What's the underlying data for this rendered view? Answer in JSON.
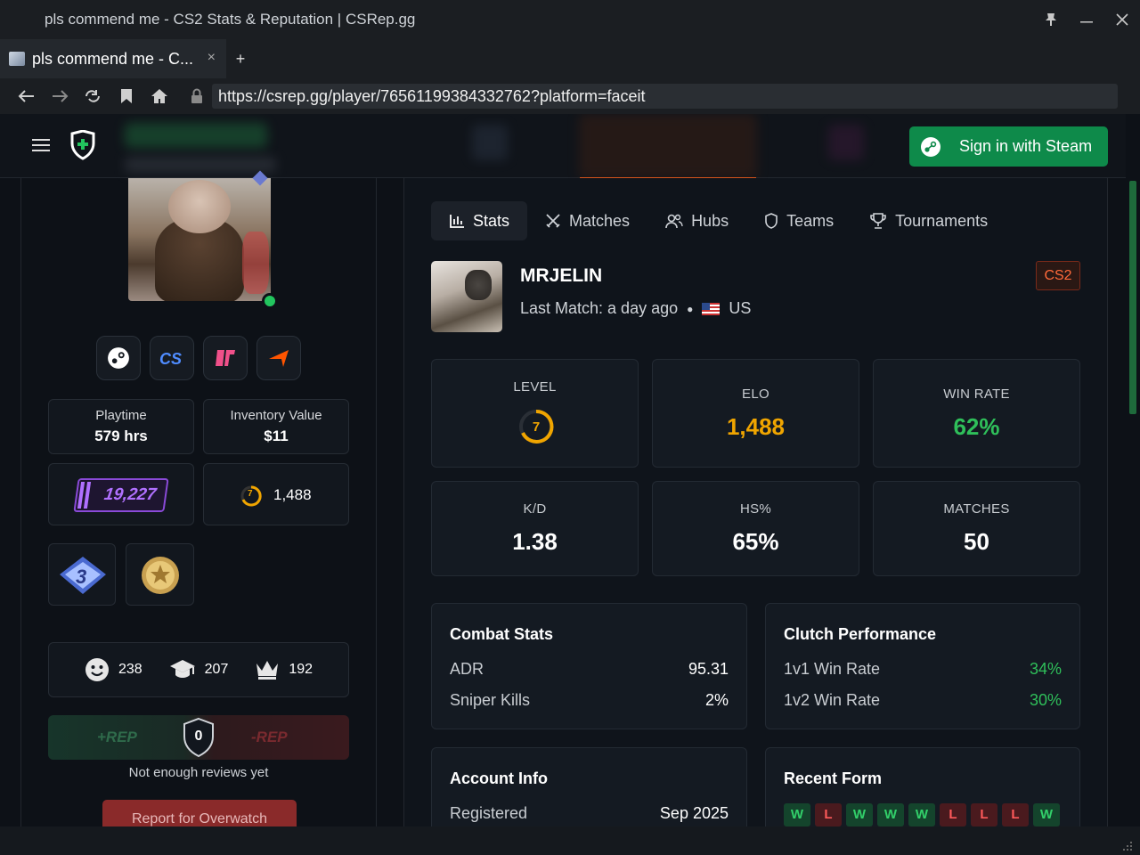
{
  "window": {
    "title": "pls commend me - CS2 Stats & Reputation | CSRep.gg"
  },
  "tab": {
    "label": "pls commend me - C...",
    "close": "×",
    "new": "+"
  },
  "address": {
    "url": "https://csrep.gg/player/76561199384332762?platform=faceit"
  },
  "nav": {
    "signin": "Sign in with Steam"
  },
  "sidebar": {
    "playtime_label": "Playtime",
    "playtime_value": "579 hrs",
    "inventory_label": "Inventory Value",
    "inventory_value": "$11",
    "premier": "19,227",
    "faceit_elo": "1,488",
    "faceit_level": "7",
    "counts": {
      "smile": "238",
      "cap": "207",
      "crown": "192"
    },
    "rep_plus": "+REP",
    "rep_minus": "-REP",
    "rep_score": "0",
    "no_reviews": "Not enough reviews yet",
    "report": "Report for Overwatch"
  },
  "tabs": [
    "Stats",
    "Matches",
    "Hubs",
    "Teams",
    "Tournaments"
  ],
  "player": {
    "name": "MRJELIN",
    "last_match": "Last Match: a day ago",
    "country": "US",
    "game_badge": "CS2"
  },
  "cards": [
    {
      "label": "LEVEL",
      "value": "7"
    },
    {
      "label": "ELO",
      "value": "1,488"
    },
    {
      "label": "WIN RATE",
      "value": "62%"
    },
    {
      "label": "K/D",
      "value": "1.38"
    },
    {
      "label": "HS%",
      "value": "65%"
    },
    {
      "label": "MATCHES",
      "value": "50"
    }
  ],
  "combat": {
    "title": "Combat Stats",
    "rows": [
      {
        "k": "ADR",
        "v": "95.31"
      },
      {
        "k": "Sniper Kills",
        "v": "2%"
      }
    ]
  },
  "clutch": {
    "title": "Clutch Performance",
    "rows": [
      {
        "k": "1v1 Win Rate",
        "v": "34%"
      },
      {
        "k": "1v2 Win Rate",
        "v": "30%"
      }
    ]
  },
  "account": {
    "title": "Account Info",
    "rows": [
      {
        "k": "Registered",
        "v": "Sep 2025"
      }
    ]
  },
  "recent_form": {
    "title": "Recent Form",
    "results": [
      "W",
      "L",
      "W",
      "W",
      "W",
      "L",
      "L",
      "L",
      "W"
    ]
  },
  "colors": {
    "accent_green": "#0e8a4a",
    "elo_orange": "#f0a500",
    "win_green": "#2fbf5a"
  }
}
